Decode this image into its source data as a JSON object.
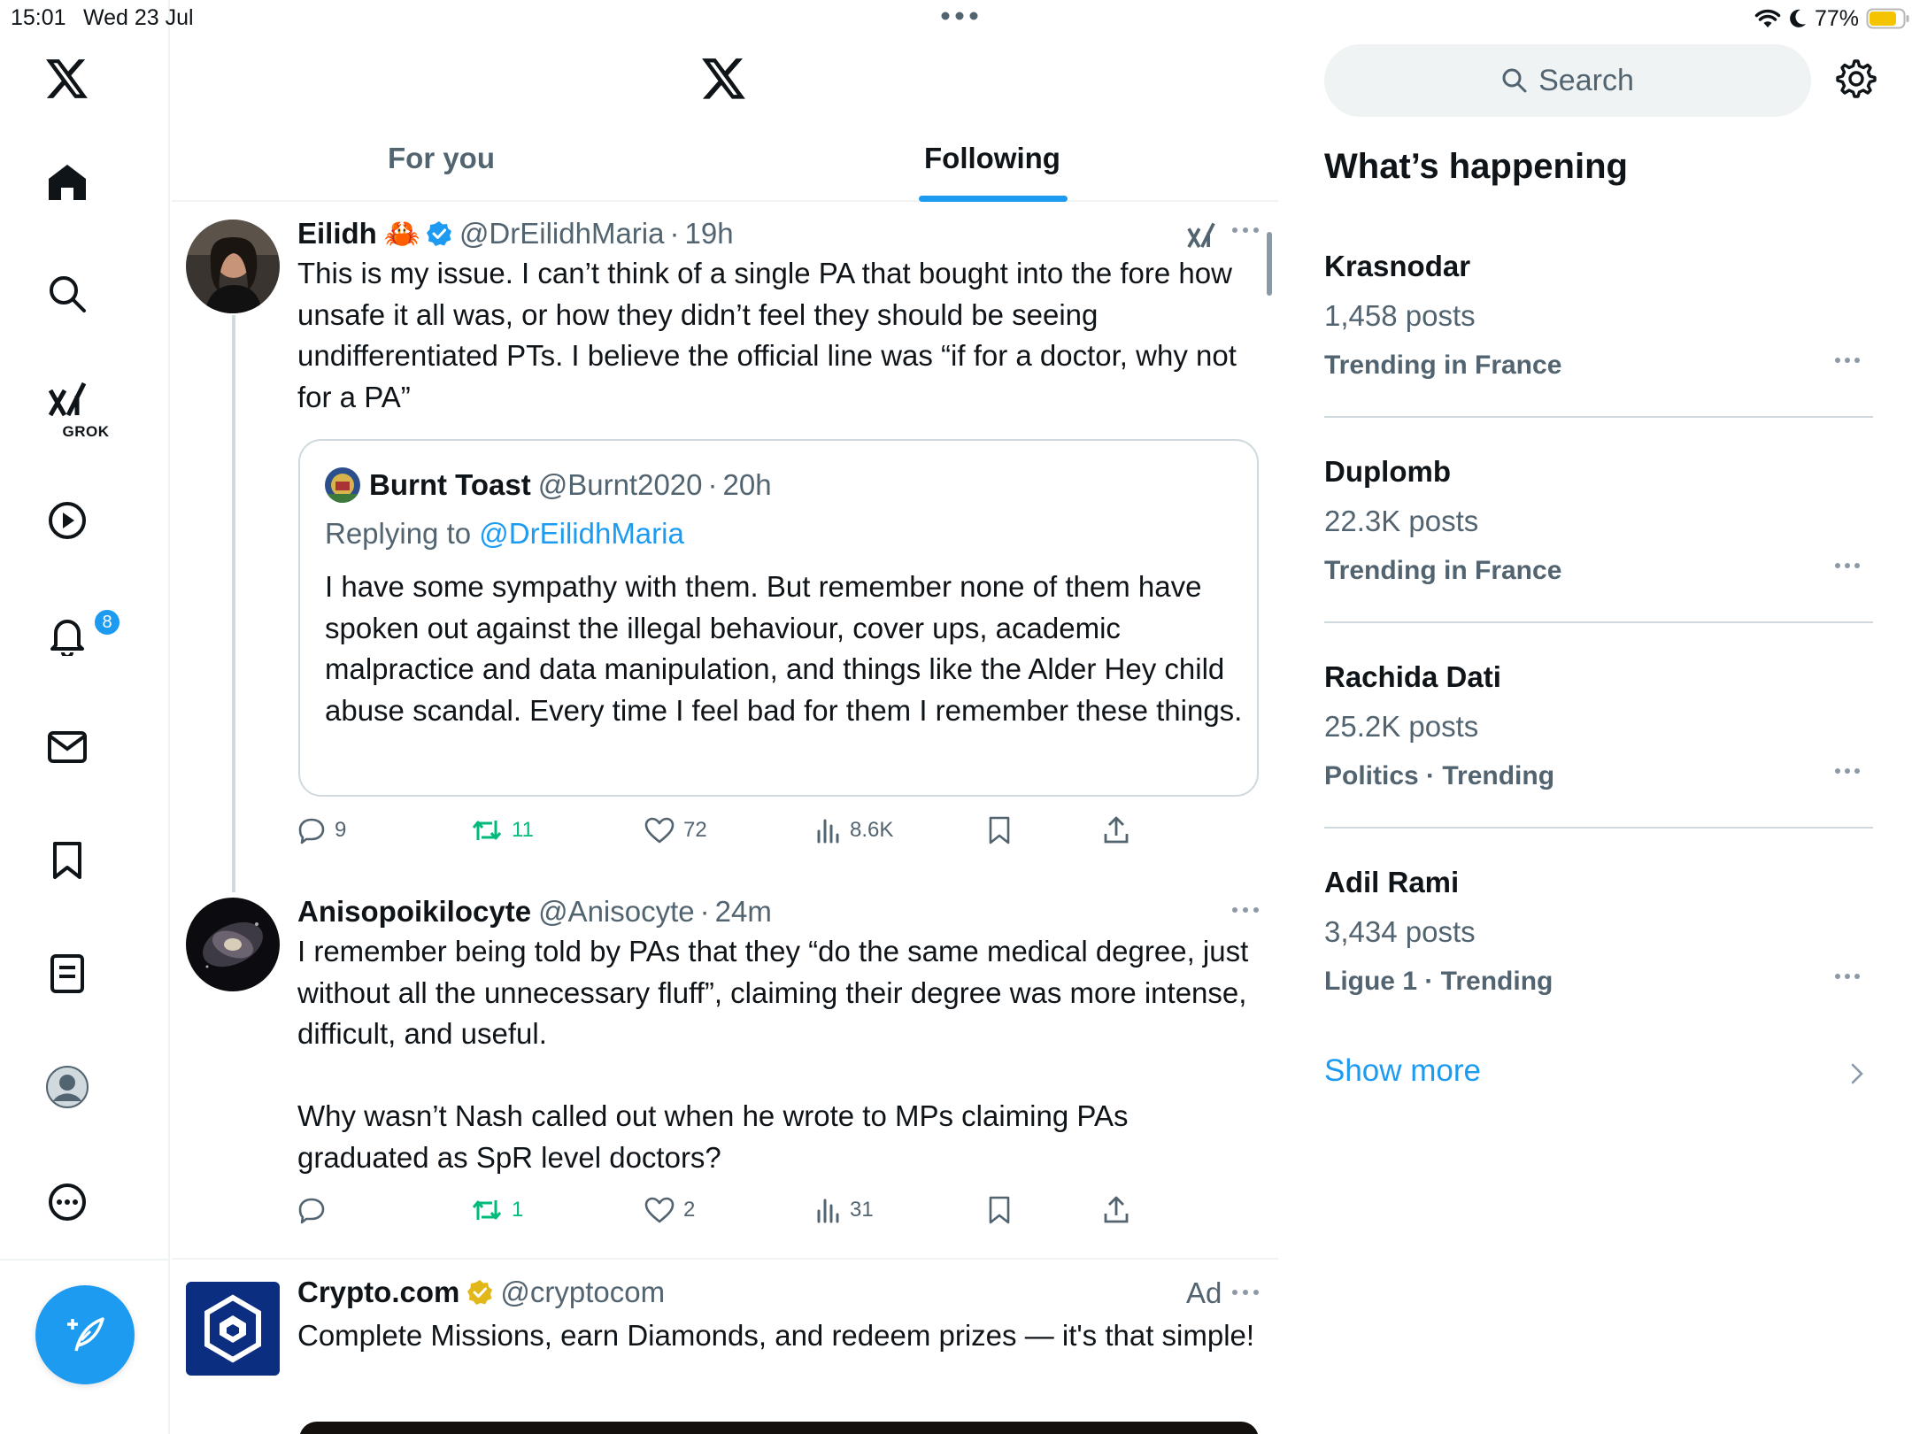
{
  "status_bar": {
    "time": "15:01",
    "date": "Wed 23 Jul",
    "battery": "77%"
  },
  "nav": {
    "items": [
      {
        "icon": "x-logo-icon"
      },
      {
        "icon": "home-icon"
      },
      {
        "icon": "search-icon"
      },
      {
        "icon": "grok-icon",
        "label": "GROK"
      },
      {
        "icon": "video-play-icon"
      },
      {
        "icon": "notifications-bell-icon",
        "badge": "8"
      },
      {
        "icon": "messages-envelope-icon"
      },
      {
        "icon": "bookmark-icon"
      },
      {
        "icon": "lists-icon"
      },
      {
        "icon": "profile-avatar-icon"
      },
      {
        "icon": "more-circle-icon"
      }
    ],
    "compose_icon": "compose-post-icon"
  },
  "header": {
    "tabs": [
      {
        "label": "For you",
        "active": false
      },
      {
        "label": "Following",
        "active": true
      }
    ]
  },
  "posts": [
    {
      "author": "Eilidh",
      "emoji": "🦀",
      "verified": true,
      "handle": "@DrEilidhMaria",
      "time": "19h",
      "text": "This is my issue. I can’t think of a single PA that bought into the fore how unsafe it all was, or how they didn’t feel they should be seeing undifferentiated PTs. I believe the official line was “if for a doctor, why not for a PA”",
      "quote": {
        "author": "Burnt Toast",
        "handle": "@Burnt2020",
        "time": "20h",
        "replying_prefix": "Replying to",
        "replying_to": "@DrEilidhMaria",
        "text": "I have some sympathy with them. But remember none of them have spoken out against the illegal behaviour, cover ups, academic malpractice and data manipulation, and things like the Alder Hey child abuse scandal. Every time I feel bad for them I remember these things."
      },
      "stats": {
        "replies": "9",
        "reposts": "11",
        "likes": "72",
        "views": "8.6K"
      }
    },
    {
      "author": "Anisopoikilocyte",
      "handle": "@Anisocyte",
      "time": "24m",
      "text": "I remember being told by PAs that they “do the same medical degree, just without all the unnecessary fluff”, claiming their degree was more intense, difficult, and useful.\n\nWhy wasn’t Nash called out when he wrote to MPs claiming PAs graduated as SpR level doctors?",
      "stats": {
        "replies": "",
        "reposts": "1",
        "likes": "2",
        "views": "31"
      }
    },
    {
      "author": "Crypto.com",
      "verified_gold": true,
      "handle": "@cryptocom",
      "ad_label": "Ad",
      "text": "Complete Missions, earn Diamonds, and redeem prizes — it's that simple!"
    }
  ],
  "sidebar": {
    "search_placeholder": "Search",
    "heading": "What’s happening",
    "trends": [
      {
        "name": "Krasnodar",
        "count": "1,458 posts",
        "meta": "Trending in France"
      },
      {
        "name": "Duplomb",
        "count": "22.3K posts",
        "meta": "Trending in France"
      },
      {
        "name": "Rachida Dati",
        "count": "25.2K posts",
        "meta": "Politics · Trending"
      },
      {
        "name": "Adil Rami",
        "count": "3,434 posts",
        "meta": "Ligue 1 · Trending"
      }
    ],
    "show_more": "Show more"
  },
  "colors": {
    "accent": "#1d9bf0",
    "repost_green": "#00ba7c",
    "text_primary": "#0f1419",
    "text_secondary": "#536471"
  }
}
